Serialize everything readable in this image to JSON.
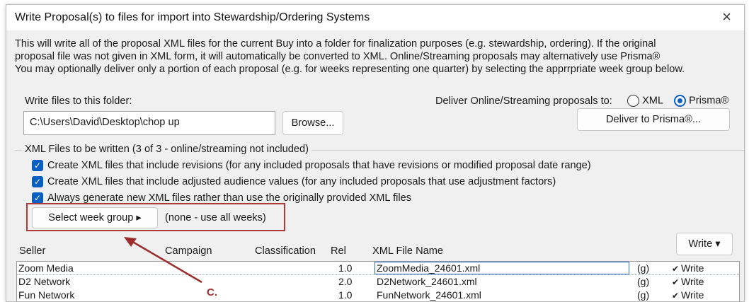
{
  "window": {
    "title": "Write Proposal(s) to files for import into Stewardship/Ordering Systems",
    "close_icon": "×"
  },
  "description": {
    "line1": "This will write all of the proposal XML files for the current Buy into a folder for finalization purposes (e.g. stewardship, ordering). If the original",
    "line2": "proposal file was not given in XML form, it will automatically be converted to XML. Online/Streaming proposals may alternatively use Prisma®",
    "line3": "You may optionally deliver only a portion of each proposal (e.g. for weeks representing one quarter) by selecting the apprrpriate week group below."
  },
  "folder": {
    "label": "Write files to this folder:",
    "value": "C:\\Users\\David\\Desktop\\chop up",
    "browse_label": "Browse..."
  },
  "delivery": {
    "label": "Deliver Online/Streaming proposals to:",
    "options": [
      {
        "label": "XML",
        "selected": false
      },
      {
        "label": "Prisma®",
        "selected": true
      }
    ],
    "prisma_button": "Deliver to Prisma®..."
  },
  "xml_files": {
    "group_label": "XML Files to be written (3 of 3 - online/streaming not included)",
    "checkboxes": [
      {
        "label": "Create XML files that include revisions (for any included proposals that have revisions or modified proposal date range)",
        "checked": true
      },
      {
        "label": "Create XML files that include adjusted audience values (for any included proposals that use adjustment factors)",
        "checked": true
      },
      {
        "label": "Always generate new XML files rather than use the originally provided XML files",
        "checked": true
      }
    ],
    "week_group_button": "Select week group",
    "week_group_arrow": "▸",
    "week_group_value": "(none - use all weeks)"
  },
  "table": {
    "write_button": "Write",
    "write_arrow": "▾",
    "columns": [
      "Seller",
      "Campaign",
      "Classification",
      "Rel",
      "XML File Name"
    ],
    "rows": [
      {
        "seller": "Zoom Media",
        "campaign": "",
        "classification": "",
        "rel": "1.0",
        "file": "ZoomMedia_24601.xml",
        "flag": "(g)",
        "write_label": "Write",
        "write_checked": true
      },
      {
        "seller": "D2 Network",
        "campaign": "",
        "classification": "",
        "rel": "2.0",
        "file": "D2Network_24601.xml",
        "flag": "(g)",
        "write_label": "Write",
        "write_checked": true
      },
      {
        "seller": "Fun Network",
        "campaign": "",
        "classification": "",
        "rel": "1.0",
        "file": "FunNetwork_24601.xml",
        "flag": "(g)",
        "write_label": "Write",
        "write_checked": true
      }
    ]
  },
  "annotation": {
    "label": "C.",
    "color": "#9c2d2d"
  },
  "colors": {
    "accent": "#0a5fc2",
    "annotation_red": "#b03a3a"
  }
}
